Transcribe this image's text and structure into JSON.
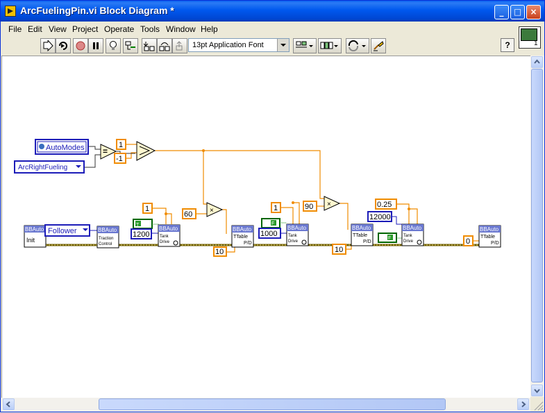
{
  "window": {
    "title": "ArcFuelingPin.vi Block Diagram *",
    "controls": {
      "minimize": "_",
      "maximize": "□",
      "close": "×"
    }
  },
  "menu": [
    "File",
    "Edit",
    "View",
    "Project",
    "Operate",
    "Tools",
    "Window",
    "Help"
  ],
  "toolbar": {
    "font_selector": "13pt Application Font",
    "help": "?",
    "vi_connector_number": "1",
    "buttons": [
      "run-icon",
      "run-continuously-icon",
      "abort-icon",
      "pause-icon",
      "highlight-execution-icon",
      "retain-wire-values-icon",
      "step-into-icon",
      "step-over-icon",
      "step-out-icon",
      "align-objects-icon",
      "distribute-objects-icon",
      "reorder-icon",
      "clean-up-diagram-icon"
    ]
  },
  "colors": {
    "orange_wire": "#f08c00",
    "blue_ref": "#1c1cb8",
    "green_bool": "#006600",
    "title_blue": "#0054e3"
  },
  "diagram": {
    "enum_automodes": "AutoModes",
    "ring_arcright": "ArcRightFueling",
    "const_1_top": "1",
    "const_neg1": "-1",
    "const_follower": "Follower",
    "const_1_a": "1",
    "const_60": "60",
    "const_1200": "1200",
    "const_10_a": "10",
    "const_1_b": "1",
    "const_1000": "1000",
    "const_90": "90",
    "const_10_b": "10",
    "const_025": "0.25",
    "const_12000": "12000",
    "const_0": "0",
    "bool_t": "T",
    "bool_f1": "F",
    "bool_f2": "F",
    "vi_header": "BBAuto",
    "vi_init": "Init",
    "vi_traction": [
      "Traction",
      "Control"
    ],
    "vi_tank": [
      "Tank",
      "Drive"
    ],
    "vi_ttable": [
      "TTable",
      "P/D"
    ]
  }
}
